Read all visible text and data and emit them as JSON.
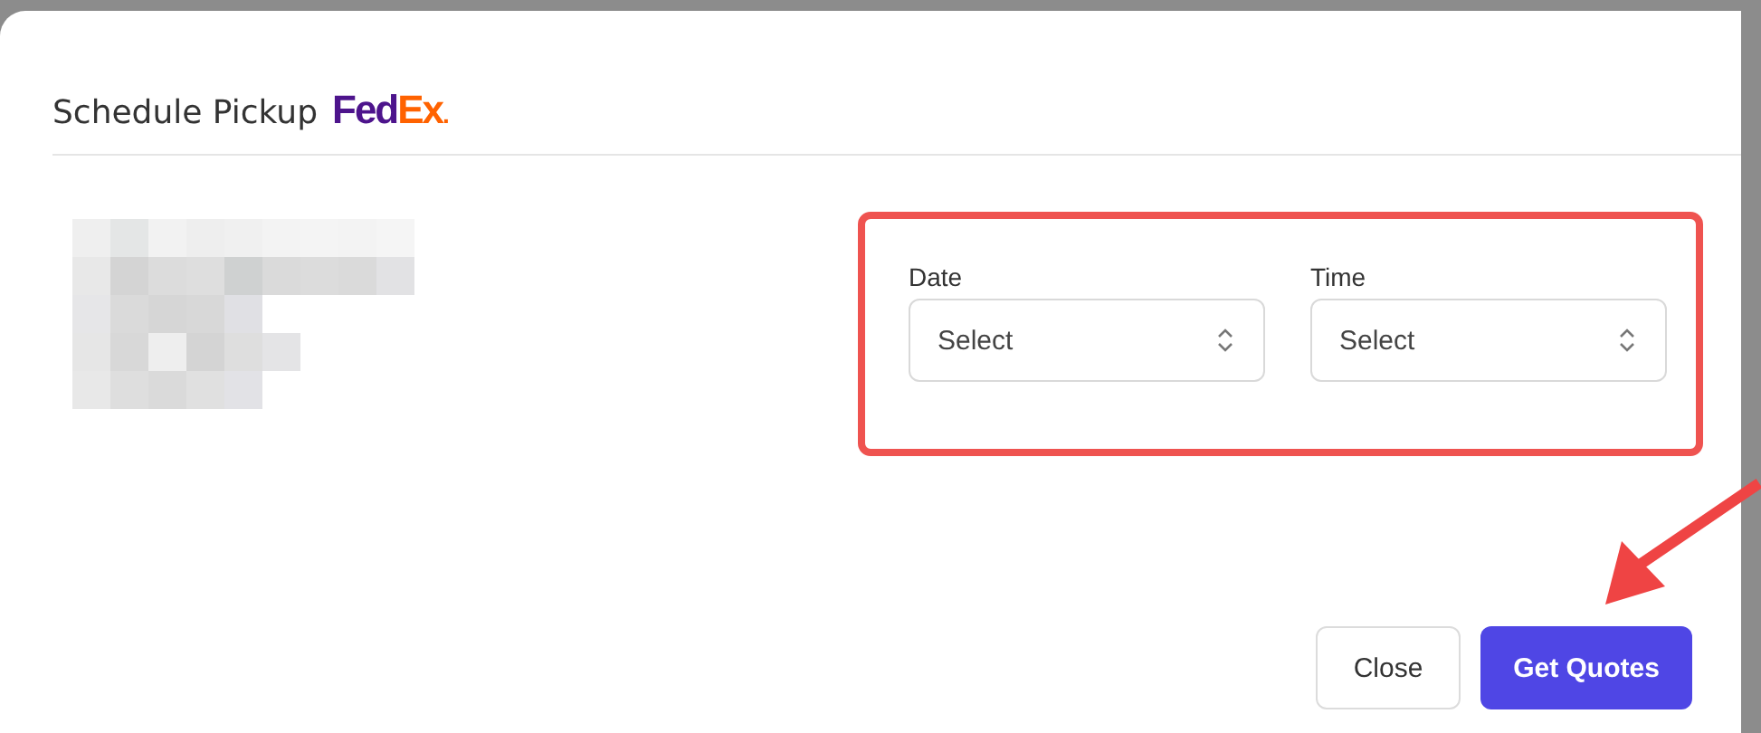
{
  "dialog": {
    "title": "Schedule Pickup",
    "logo": [
      {
        "text": "Fed",
        "color": "#4d148c"
      },
      {
        "text": "Ex",
        "color": "#ff6200"
      },
      {
        "text": ".",
        "color": "#ff6200"
      }
    ],
    "fields": [
      {
        "label": "Date",
        "placeholder": "Select"
      },
      {
        "label": "Time",
        "placeholder": "Select"
      }
    ],
    "buttons": [
      {
        "label": "Close",
        "kind": "secondary"
      },
      {
        "label": "Get Quotes",
        "kind": "primary"
      }
    ]
  },
  "annotations": {
    "highlight_fields": true,
    "pointer_arrow": true
  }
}
